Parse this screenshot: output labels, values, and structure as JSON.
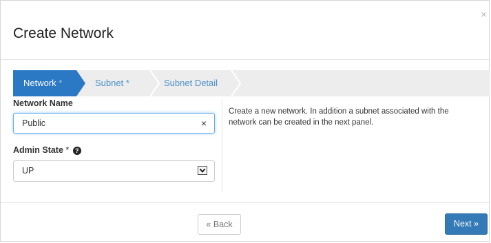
{
  "dialog": {
    "title": "Create Network",
    "close_glyph": "×"
  },
  "wizard": {
    "steps": [
      {
        "label": "Network",
        "required_mark": "*",
        "active": true
      },
      {
        "label": "Subnet",
        "required_mark": "*",
        "active": false
      },
      {
        "label": "Subnet Detail",
        "required_mark": "",
        "active": false
      }
    ]
  },
  "form": {
    "network_name": {
      "label": "Network Name",
      "value": "Public",
      "clear_glyph": "×"
    },
    "admin_state": {
      "label": "Admin State",
      "required_mark": "*",
      "help_glyph": "?",
      "selected": "UP"
    }
  },
  "help_text": "Create a new network. In addition a subnet associated with the network can be created in the next panel.",
  "footer": {
    "back_label": "« Back",
    "next_label": "Next »"
  },
  "colors": {
    "primary": "#337ab7",
    "active_step": "#2b78c5",
    "wizard_bg": "#ededed"
  }
}
